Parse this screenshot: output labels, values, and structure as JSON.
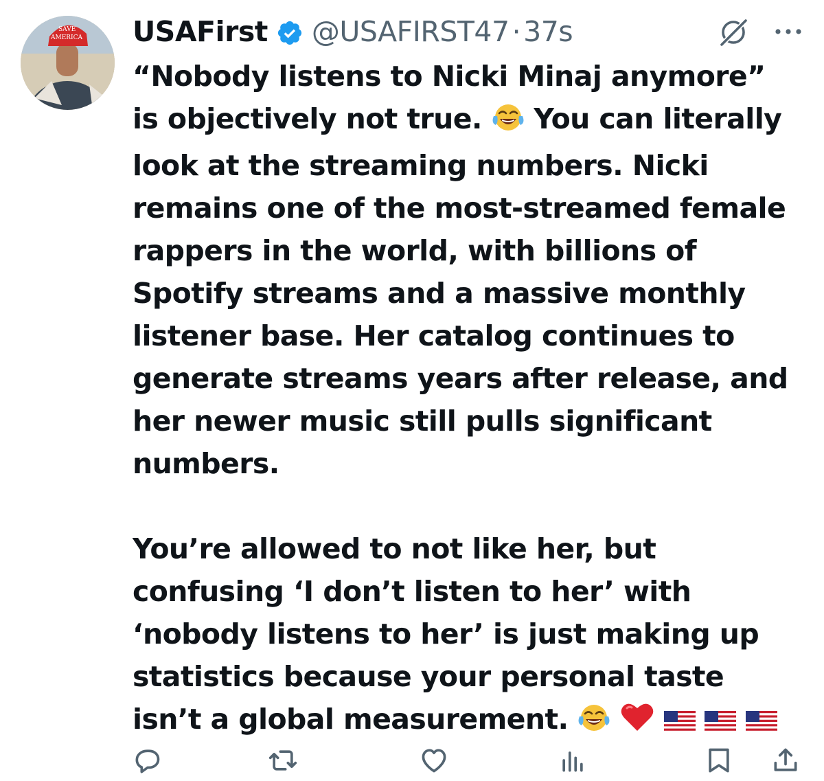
{
  "tweet": {
    "display_name": "USAFirst",
    "handle": "@USAFIRST47",
    "separator": "·",
    "time": "37s",
    "verified_icon": "verified-badge-icon",
    "avatar_hat_text_1": "SAVE",
    "avatar_hat_text_2": "AMERICA",
    "body_lines": [
      "“Nobody listens to Nicki Minaj anymore”",
      "is objectively not true.",
      "You can literally",
      "look at the streaming numbers. Nicki",
      "remains one of the most-streamed female",
      "rappers in the world, with billions of",
      "Spotify streams and a massive monthly",
      "listener base. Her catalog continues to",
      "generate streams years after release, and",
      "her newer music still pulls significant",
      "numbers."
    ],
    "body_lines_2": [
      "You’re allowed to not like her, but",
      "confusing ‘I don’t listen to her’ with",
      "‘nobody listens to her’ is just making up",
      "statistics because your personal taste",
      "isn’t a global measurement."
    ],
    "emojis": [
      "face-with-tears-of-joy",
      "red-heart",
      "us-flag",
      "us-flag",
      "us-flag"
    ]
  },
  "icons": {
    "grok": "grok-icon",
    "more": "more-icon",
    "reply": "reply-icon",
    "retweet": "retweet-icon",
    "like": "like-icon",
    "views": "views-icon",
    "bookmark": "bookmark-icon",
    "share": "share-icon"
  },
  "colors": {
    "text": "#0f1419",
    "secondary": "#536471",
    "verified": "#1d9bf0",
    "icon": "#536471"
  }
}
